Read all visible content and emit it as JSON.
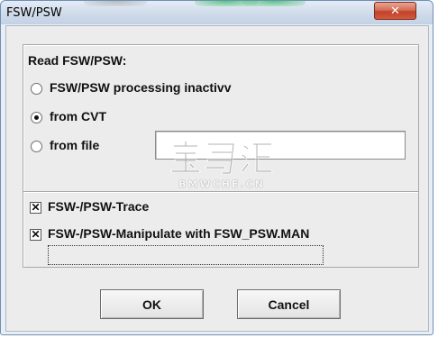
{
  "window": {
    "title": "FSW/PSW",
    "close_glyph": "✕"
  },
  "read_group": {
    "heading": "Read FSW/PSW:",
    "options": [
      {
        "label": "FSW/PSW processing inactivv",
        "selected": false
      },
      {
        "label": "from CVT",
        "selected": true
      },
      {
        "label": "from file",
        "selected": false
      }
    ],
    "file_field": {
      "value": ""
    }
  },
  "options_group": {
    "checkboxes": [
      {
        "label": "FSW-/PSW-Trace",
        "checked": true
      },
      {
        "label": "FSW-/PSW-Manipulate with FSW_PSW.MAN",
        "checked": true
      }
    ]
  },
  "buttons": {
    "ok": "OK",
    "cancel": "Cancel"
  },
  "watermark": {
    "chars": "宝马汇",
    "sub": "BMWCHE.CN"
  },
  "colors": {
    "titlebar": "#cfdbea",
    "close_button": "#c2412a",
    "dialog_bg": "#ececec",
    "accent_glow": "#3fbf6a"
  }
}
